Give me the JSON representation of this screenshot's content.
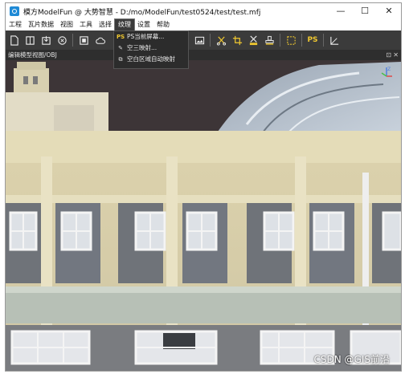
{
  "window": {
    "title": "模方ModelFun @ 大势智慧 - D:/mo/ModelFun/test0524/test/test.mfj",
    "controls": {
      "minimize": "—",
      "maximize": "☐",
      "close": "✕"
    }
  },
  "menubar": {
    "items": [
      "工程",
      "瓦片数据",
      "视图",
      "工具",
      "选择",
      "纹理",
      "设置",
      "帮助"
    ],
    "active_index": 5
  },
  "toolbar": {
    "icons": [
      "new-file-icon",
      "layout-icon",
      "import-icon",
      "close-circle-icon",
      "stop-square-icon",
      "cloud-icon",
      "brush-icon",
      "image-icon",
      "cut-icon",
      "crop-icon",
      "paint-select-icon",
      "stamp-icon",
      "select-rect-icon",
      "photoshop-icon",
      "axis-angle-icon"
    ],
    "ps_label": "PS"
  },
  "dropdown": {
    "items": [
      {
        "icon": "PS",
        "label": "PS当前屏幕..."
      },
      {
        "icon": "✎",
        "label": "空三映射..."
      },
      {
        "icon": "⧉",
        "label": "空白区域自动映射"
      }
    ]
  },
  "panel": {
    "title": "编辑模型视图/OBJ",
    "buttons": {
      "float": "⊡",
      "close": "✕"
    }
  },
  "viewport": {
    "axis_label": "Z",
    "watermark": "CSDN @GIS前沿"
  },
  "colors": {
    "toolbar_bg": "#3b3b3b",
    "menu_active": "#3a3a3a",
    "facade": "#d9cfa6",
    "sky": "#3d3537"
  }
}
